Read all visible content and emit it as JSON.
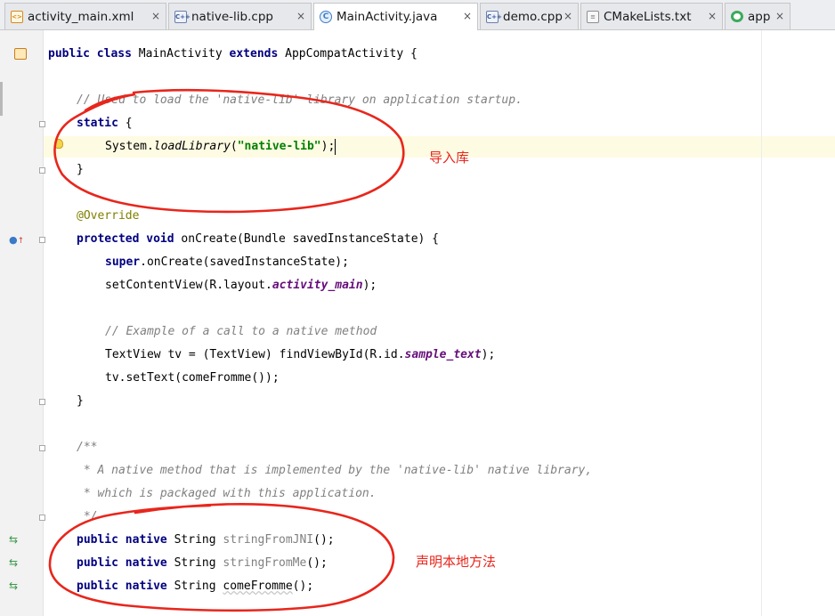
{
  "tabs": [
    {
      "label": "activity_main.xml",
      "icon": "xml-file-icon"
    },
    {
      "label": "native-lib.cpp",
      "icon": "cpp-file-icon"
    },
    {
      "label": "MainActivity.java",
      "icon": "java-class-icon",
      "active": true
    },
    {
      "label": "demo.cpp",
      "icon": "cpp-file-icon"
    },
    {
      "label": "CMakeLists.txt",
      "icon": "text-file-icon"
    },
    {
      "label": "app",
      "icon": "android-module-icon"
    }
  ],
  "tab_close_glyph": "×",
  "code": {
    "l1": {
      "kw1": "public",
      "kw2": "class",
      "name1": "MainActivity",
      "kw3": "extends",
      "name2": "AppCompatActivity {"
    },
    "l2": "// Used to load the 'native-lib' library on application startup.",
    "l3": {
      "kw": "static",
      "rest": " {"
    },
    "l4": {
      "a": "System.",
      "m": "loadLibrary",
      "b": "(",
      "s": "\"native-lib\"",
      "c": ");"
    },
    "l5": "}",
    "l6": "@Override",
    "l7": {
      "kw1": "protected",
      "kw2": "void",
      "rest": " onCreate(Bundle savedInstanceState) {"
    },
    "l8": {
      "kw": "super",
      "rest": ".onCreate(savedInstanceState);"
    },
    "l9": {
      "a": "setContentView(R.layout.",
      "f": "activity_main",
      "b": ");"
    },
    "l10": "// Example of a call to a native method",
    "l11": {
      "a": "TextView tv = (TextView) findViewById(R.id.",
      "f": "sample_text",
      "b": ");"
    },
    "l12": "tv.setText(comeFromme());",
    "l13": "}",
    "l14": "/**",
    "l15": " * A native method that is implemented by the 'native-lib' native library,",
    "l16": " * which is packaged with this application.",
    "l17": " */",
    "l18": {
      "kw1": "public",
      "kw2": "native",
      "type": " String ",
      "name": "stringFromJNI",
      "end": "();"
    },
    "l19": {
      "kw1": "public",
      "kw2": "native",
      "type": " String ",
      "name": "stringFromMe",
      "end": "();"
    },
    "l20": {
      "kw1": "public",
      "kw2": "native",
      "type": " String ",
      "name": "comeFromme",
      "end": "();"
    }
  },
  "annotations": {
    "import_library": "导入库",
    "declare_native_methods": "声明本地方法"
  },
  "colors": {
    "keyword": "#000080",
    "comment": "#808080",
    "string": "#008000",
    "annotation": "#808000",
    "field": "#660e7a",
    "markup_red": "#e8261c",
    "current_line": "#fefbe3"
  }
}
